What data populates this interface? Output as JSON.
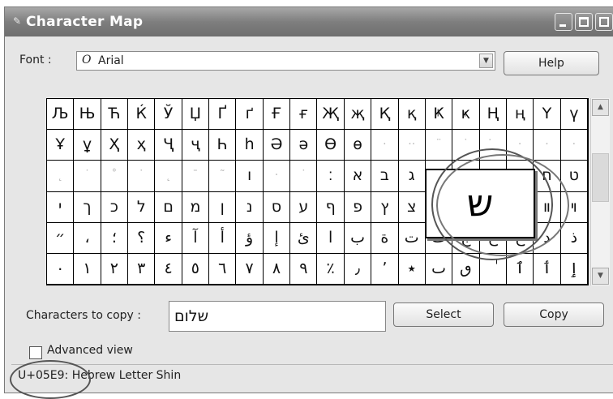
{
  "window": {
    "title": "Character Map"
  },
  "font": {
    "label": "Font :",
    "value": "Arial",
    "glyph": "O"
  },
  "buttons": {
    "help": "Help",
    "select": "Select",
    "copy": "Copy"
  },
  "grid": {
    "rows": [
      [
        "Љ",
        "Њ",
        "Ћ",
        "Ќ",
        "Ў",
        "Џ",
        "Ґ",
        "ґ",
        "Ғ",
        "ғ",
        "Җ",
        "җ",
        "Қ",
        "қ",
        "Ҝ",
        "ҝ",
        "Ң",
        "ң",
        "Ү",
        "ү"
      ],
      [
        "Ұ",
        "ұ",
        "Ҳ",
        "ҳ",
        "Ҷ",
        "ҷ",
        "Һ",
        "һ",
        "Ә",
        "ә",
        "Ө",
        "ө",
        "·",
        "··",
        "¨",
        "˙",
        "̇",
        "·",
        "·",
        "·"
      ],
      [
        "˛",
        "˙",
        "˚",
        "˙",
        "˛",
        "¯",
        "˜",
        "ı",
        "·",
        "˙",
        "׃",
        "א",
        "ב",
        "ג",
        "ד",
        "ה",
        "ו",
        "ז",
        "ח",
        "ט"
      ],
      [
        "י",
        "ך",
        "כ",
        "ל",
        "ם",
        "מ",
        "ן",
        "נ",
        "ס",
        "ע",
        "ף",
        "פ",
        "ץ",
        "צ",
        "ק",
        "ר",
        "ש",
        "ת",
        "װ",
        "ױ"
      ],
      [
        "״",
        "،",
        "؛",
        "؟",
        "ء",
        "آ",
        "أ",
        "ؤ",
        "إ",
        "ئ",
        "ا",
        "ب",
        "ة",
        "ت",
        "ث",
        "ج",
        "ح",
        "خ",
        "د",
        "ذ"
      ],
      [
        "٠",
        "١",
        "٢",
        "٣",
        "٤",
        "٥",
        "٦",
        "٧",
        "٨",
        "٩",
        "٪",
        "٫",
        "٬",
        "٭",
        "ٮ",
        "ٯ",
        "ٰ",
        "ٱ",
        "ٲ",
        "ٳ"
      ]
    ]
  },
  "zoom": {
    "char": "ש"
  },
  "copy": {
    "label": "Characters to copy :",
    "value": "שלום"
  },
  "advanced": {
    "label": "Advanced view",
    "checked": false
  },
  "status": {
    "text": "U+05E9: Hebrew Letter Shin"
  }
}
